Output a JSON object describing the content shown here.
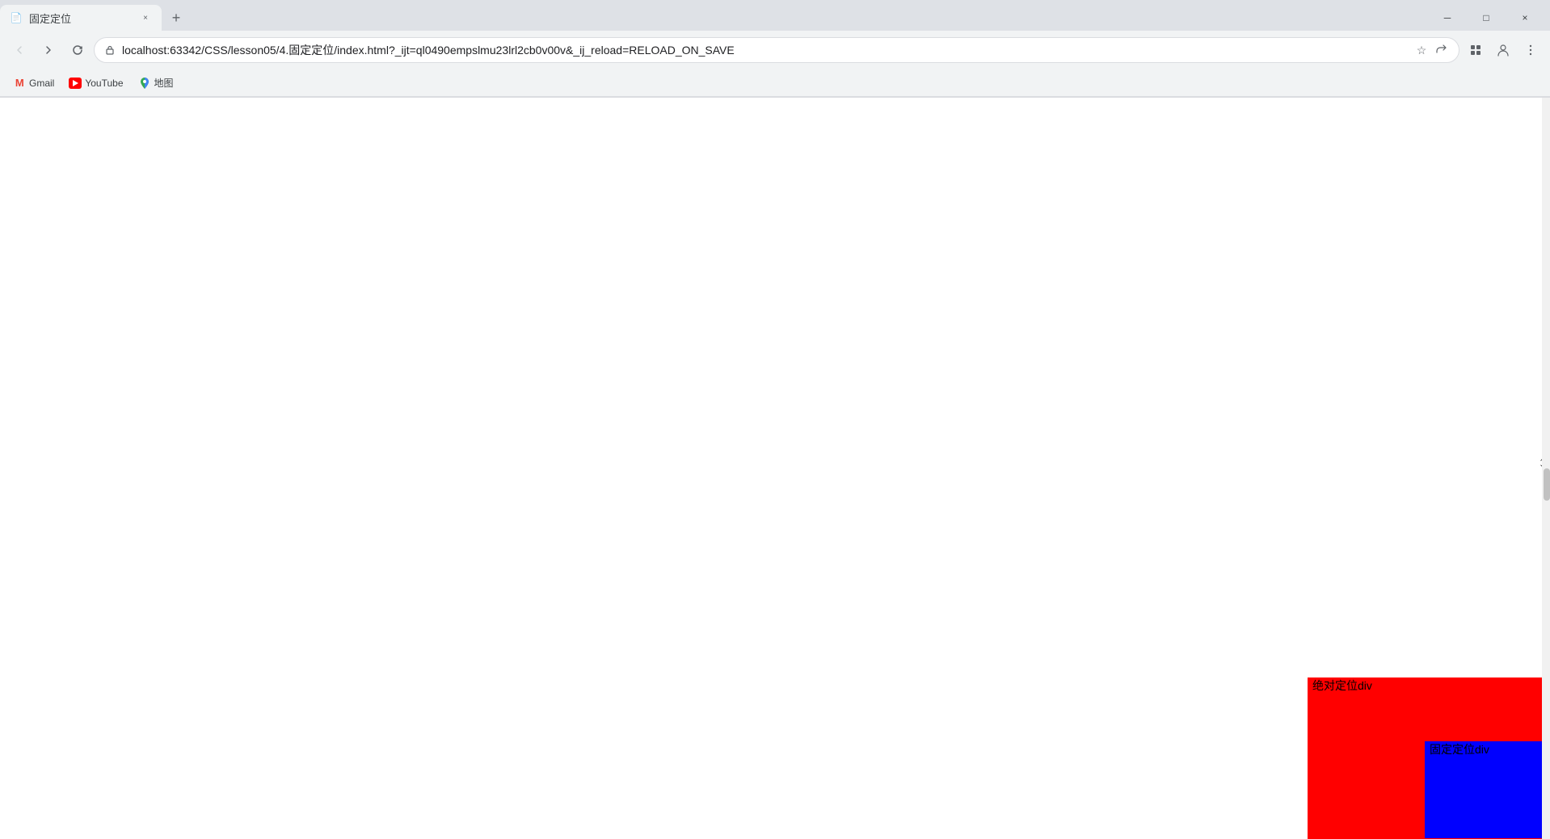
{
  "browser": {
    "tab": {
      "favicon": "📄",
      "title": "固定定位",
      "close_icon": "×"
    },
    "new_tab_icon": "+",
    "window_controls": {
      "minimize": "─",
      "maximize": "□",
      "close": "×"
    },
    "nav": {
      "back_icon": "←",
      "forward_icon": "→",
      "refresh_icon": "↻"
    },
    "url": "localhost:63342/CSS/lesson05/4.固定定位/index.html?_ijt=ql0490empslmu23lrl2cb0v00v&_ij_reload=RELOAD_ON_SAVE",
    "url_icons": {
      "lock": "🔒",
      "star": "☆",
      "share": "↗",
      "profile": "👤",
      "settings": "⋮"
    },
    "bookmarks": [
      {
        "id": "gmail",
        "label": "Gmail",
        "type": "gmail"
      },
      {
        "id": "youtube",
        "label": "YouTube",
        "type": "youtube"
      },
      {
        "id": "maps",
        "label": "地图",
        "type": "maps"
      }
    ]
  },
  "page": {
    "red_box_label": "绝对定位div",
    "blue_box_label": "固定定位div"
  }
}
